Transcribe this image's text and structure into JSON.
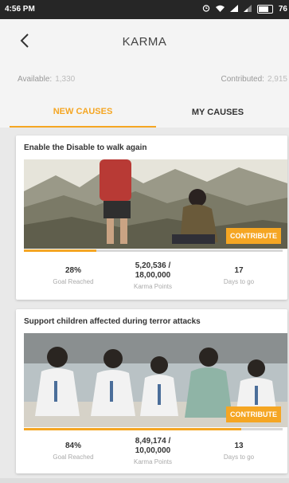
{
  "status": {
    "time": "4:56 PM",
    "battery": "76"
  },
  "header": {
    "title": "KARMA"
  },
  "balances": {
    "available_label": "Available:",
    "available_value": "1,330",
    "contributed_label": "Contributed:",
    "contributed_value": "2,915"
  },
  "tabs": [
    {
      "label": "NEW CAUSES",
      "active": true
    },
    {
      "label": "MY CAUSES",
      "active": false
    }
  ],
  "causes": [
    {
      "title": "Enable the Disable to walk again",
      "button": "CONTRIBUTE",
      "progress": 0.28,
      "goal_value": "28%",
      "goal_label": "Goal Reached",
      "points_value": "5,20,536 /",
      "points_total": "18,00,000",
      "points_label": "Karma Points",
      "days_value": "17",
      "days_label": "Days to go"
    },
    {
      "title": "Support children affected during terror attacks",
      "button": "CONTRIBUTE",
      "progress": 0.84,
      "goal_value": "84%",
      "goal_label": "Goal Reached",
      "points_value": "8,49,174 /",
      "points_total": "10,00,000",
      "points_label": "Karma Points",
      "days_value": "13",
      "days_label": "Days to go"
    }
  ],
  "colors": {
    "accent": "#f5a623"
  }
}
